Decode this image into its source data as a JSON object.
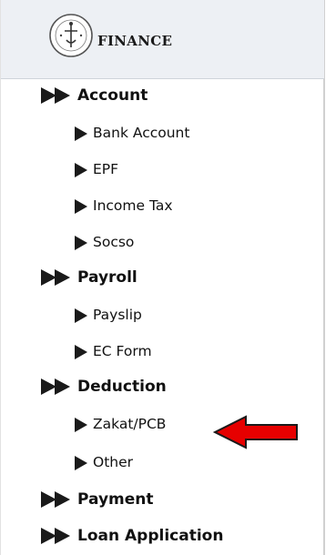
{
  "header": {
    "title": "FINANCE",
    "logo_icon": "finance-emblem-icon"
  },
  "menu": {
    "account": "Account",
    "bank_account": "Bank Account",
    "epf": "EPF",
    "income_tax": "Income Tax",
    "socso": "Socso",
    "payroll": "Payroll",
    "payslip": "Payslip",
    "ec_form": "EC Form",
    "deduction": "Deduction",
    "zakat_pcb": "Zakat/PCB",
    "other": "Other",
    "payment": "Payment",
    "loan_application": "Loan Application"
  },
  "annotation": {
    "icon": "red-arrow-icon",
    "color": "#e60000"
  }
}
